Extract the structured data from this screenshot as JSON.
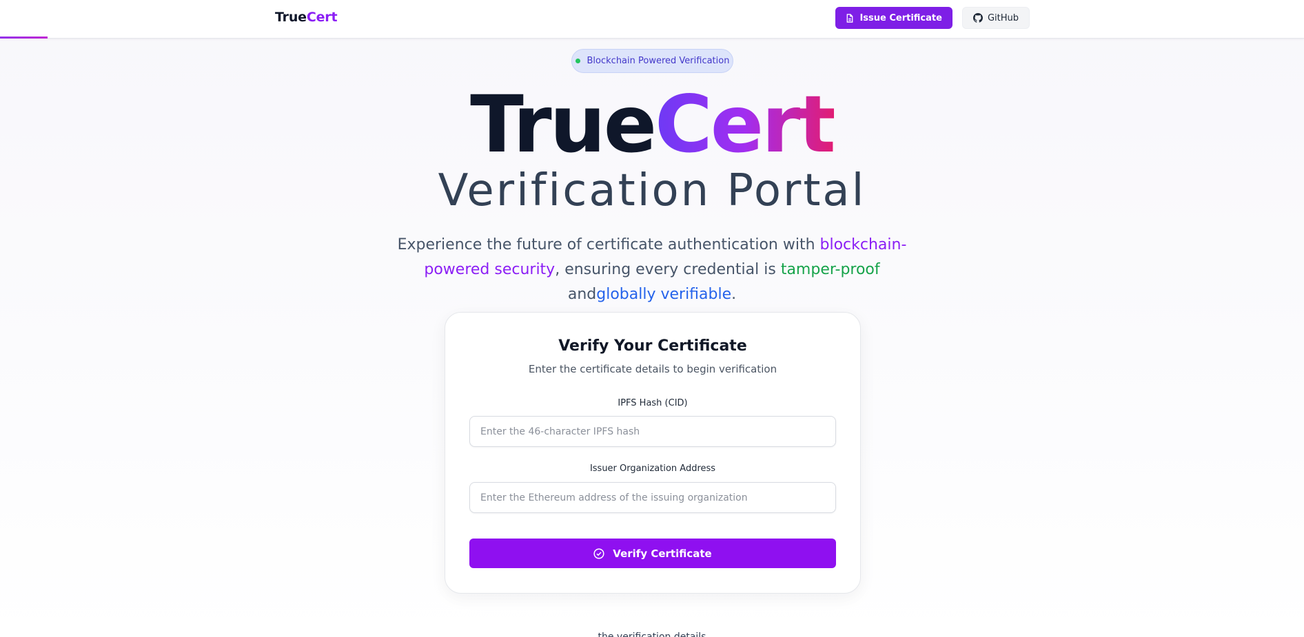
{
  "header": {
    "brand_part1": "True",
    "brand_part2": "Cert",
    "issue_label": "Issue Certificate",
    "github_label": "GitHub"
  },
  "hero": {
    "badge": "Blockchain Powered Verification",
    "title_part1": "True",
    "title_part2": "Cert",
    "subtitle": "Verification Portal",
    "lede": {
      "p1": "Experience the future of certificate authentication with ",
      "h1": "blockchain-powered security",
      "p2": ", ensuring every credential is ",
      "h2": "tamper-proof",
      "p3": " and",
      "h3": "globally verifiable",
      "p4": "."
    }
  },
  "card": {
    "title": "Verify Your Certificate",
    "subtitle": "Enter the certificate details to begin verification",
    "ipfs_label": "IPFS Hash (CID)",
    "ipfs_placeholder": "Enter the 46-character IPFS hash",
    "ipfs_value": "",
    "issuer_label": "Issuer Organization Address",
    "issuer_placeholder": "Enter the Ethereum address of the issuing organization",
    "issuer_value": "",
    "verify_label": "Verify Certificate"
  },
  "footer_peek": "... the verification details ...",
  "colors": {
    "accent_purple": "#8f10f0",
    "brand_purple": "#8b1ef5",
    "green": "#16a34a",
    "blue": "#2563eb",
    "badge_bg": "#dde4fb",
    "badge_dot": "#22c55e"
  },
  "icons": {
    "issue_button": "document-icon",
    "github_button": "github-icon",
    "verify_button": "check-circle-icon"
  }
}
